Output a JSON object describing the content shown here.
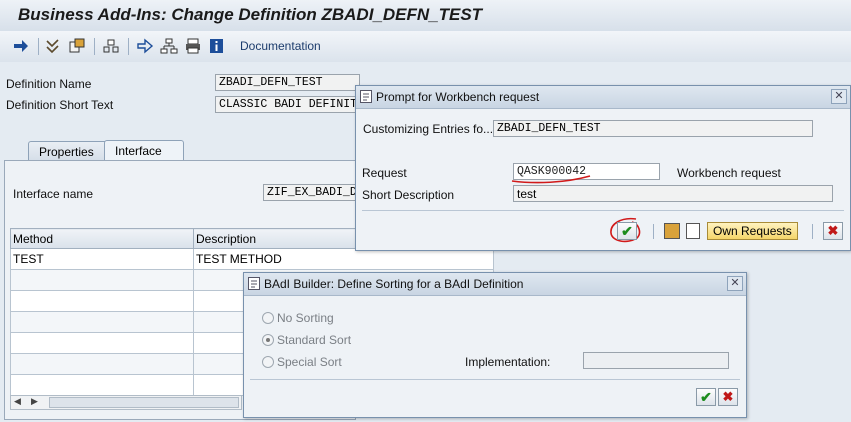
{
  "window": {
    "title": "Business Add-Ins: Change Definition ZBADI_DEFN_TEST"
  },
  "toolbar": {
    "documentation_label": "Documentation"
  },
  "definition": {
    "name_label": "Definition Name",
    "name_value": "ZBADI_DEFN_TEST",
    "short_text_label": "Definition Short Text",
    "short_text_value": "CLASSIC BADI DEFINITIO"
  },
  "tabs": [
    {
      "label": "Properties"
    },
    {
      "label": "Interface"
    }
  ],
  "interface": {
    "name_label": "Interface name",
    "name_value": "ZIF_EX_BADI_D"
  },
  "methods_table": {
    "columns": [
      "Method",
      "Description"
    ],
    "rows": [
      {
        "method": "TEST",
        "description": "TEST METHOD"
      }
    ]
  },
  "prompt_dialog": {
    "title": "Prompt for Workbench request",
    "customizing_label": "Customizing Entries fo...",
    "customizing_value": "ZBADI_DEFN_TEST",
    "request_label": "Request",
    "request_value": "QASK900042",
    "request_type": "Workbench request",
    "short_desc_label": "Short Description",
    "short_desc_value": "test",
    "own_requests_label": "Own Requests"
  },
  "sort_dialog": {
    "title": "BAdI Builder: Define Sorting for a BAdI Definition",
    "options": [
      "No Sorting",
      "Standard Sort",
      "Special Sort"
    ],
    "selected_option": "Standard Sort",
    "implementation_label": "Implementation:",
    "implementation_value": ""
  },
  "colors": {
    "accent_blue": "#1c3c6c",
    "annotation_red": "#d11a1a",
    "ok_green": "#1d8c1d",
    "cancel_red": "#c01818"
  }
}
